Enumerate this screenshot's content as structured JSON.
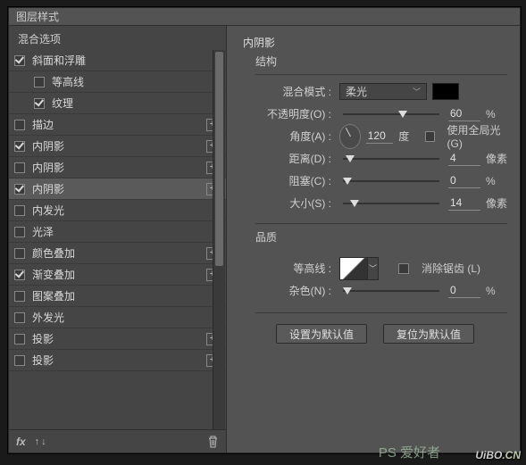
{
  "window": {
    "title": "图层样式"
  },
  "left": {
    "head": "混合选项",
    "items": [
      {
        "label": "斜面和浮雕",
        "checked": true,
        "indent": false,
        "plus": false,
        "selected": false
      },
      {
        "label": "等高线",
        "checked": false,
        "indent": true,
        "plus": false,
        "selected": false
      },
      {
        "label": "纹理",
        "checked": true,
        "indent": true,
        "plus": false,
        "selected": false
      },
      {
        "label": "描边",
        "checked": false,
        "indent": false,
        "plus": true,
        "selected": false
      },
      {
        "label": "内阴影",
        "checked": true,
        "indent": false,
        "plus": true,
        "selected": false
      },
      {
        "label": "内阴影",
        "checked": false,
        "indent": false,
        "plus": true,
        "selected": false
      },
      {
        "label": "内阴影",
        "checked": true,
        "indent": false,
        "plus": true,
        "selected": true
      },
      {
        "label": "内发光",
        "checked": false,
        "indent": false,
        "plus": false,
        "selected": false
      },
      {
        "label": "光泽",
        "checked": false,
        "indent": false,
        "plus": false,
        "selected": false
      },
      {
        "label": "颜色叠加",
        "checked": false,
        "indent": false,
        "plus": true,
        "selected": false
      },
      {
        "label": "渐变叠加",
        "checked": true,
        "indent": false,
        "plus": true,
        "selected": false
      },
      {
        "label": "图案叠加",
        "checked": false,
        "indent": false,
        "plus": false,
        "selected": false
      },
      {
        "label": "外发光",
        "checked": false,
        "indent": false,
        "plus": false,
        "selected": false
      },
      {
        "label": "投影",
        "checked": false,
        "indent": false,
        "plus": true,
        "selected": false
      },
      {
        "label": "投影",
        "checked": false,
        "indent": false,
        "plus": true,
        "selected": false
      }
    ],
    "foot_fx": "fx"
  },
  "right": {
    "title": "内阴影",
    "section1": "结构",
    "blend_label": "混合模式 :",
    "blend_value": "柔光",
    "opacity_label": "不透明度(O) :",
    "opacity_value": "60",
    "opacity_unit": "%",
    "angle_label": "角度(A) :",
    "angle_value": "120",
    "angle_unit": "度",
    "global_label": "使用全局光 (G)",
    "distance_label": "距离(D) :",
    "distance_value": "4",
    "distance_unit": "像素",
    "choke_label": "阻塞(C) :",
    "choke_value": "0",
    "choke_unit": "%",
    "size_label": "大小(S) :",
    "size_value": "14",
    "size_unit": "像素",
    "section2": "品质",
    "contour_label": "等高线 :",
    "aa_label": "消除锯齿 (L)",
    "noise_label": "杂色(N) :",
    "noise_value": "0",
    "noise_unit": "%",
    "btn_default": "设置为默认值",
    "btn_reset": "复位为默认值"
  },
  "watermark": {
    "site": "UiBO",
    "cn": ".CN",
    "tag": "PS 爱好者"
  }
}
